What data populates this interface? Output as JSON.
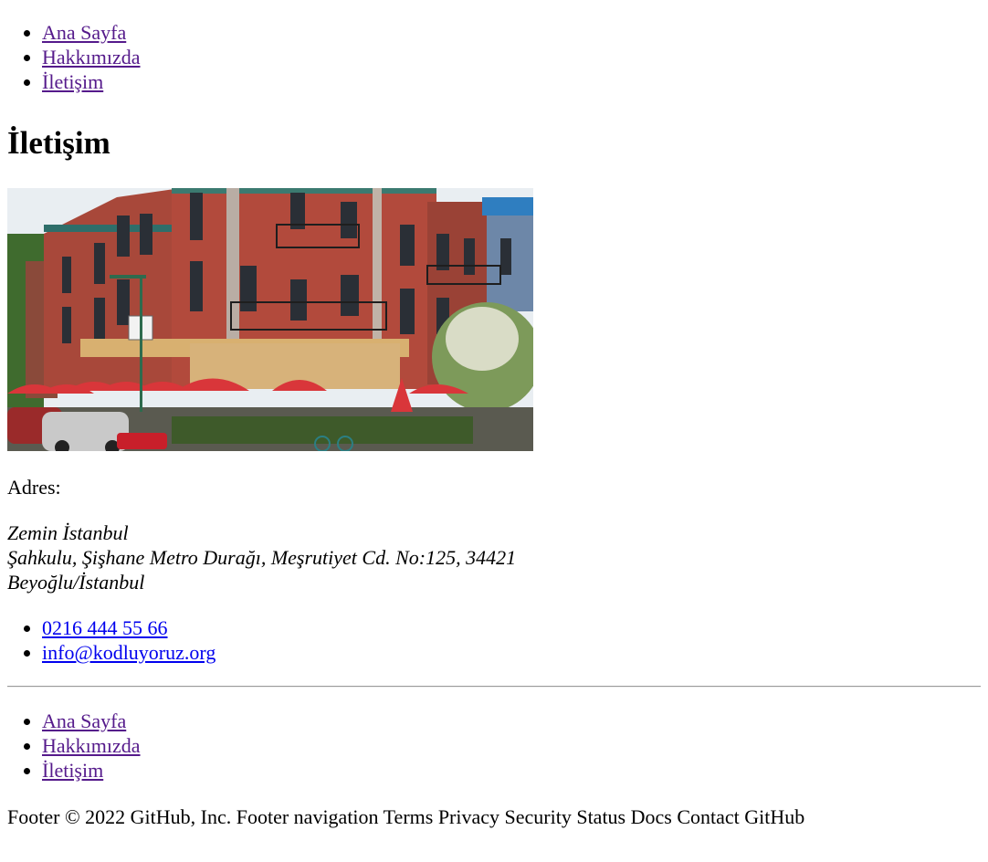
{
  "top_nav": {
    "items": [
      "Ana Sayfa",
      "Hakkımızda",
      "İletişim"
    ]
  },
  "page_title": "İletişim",
  "photo": {
    "description_icon": "building-photo"
  },
  "address_label": "Adres:",
  "address": {
    "line1": "Zemin İstanbul",
    "line2": "Şahkulu, Şişhane Metro Durağı, Meşrutiyet Cd. No:125, 34421",
    "line3": "Beyoğlu/İstanbul"
  },
  "contact": {
    "phone": "0216 444 55 66",
    "email": "info@kodluyoruz.org"
  },
  "footer_nav": {
    "items": [
      "Ana Sayfa",
      "Hakkımızda",
      "İletişim"
    ]
  },
  "footer_text": "Footer © 2022 GitHub, Inc. Footer navigation Terms Privacy Security Status Docs Contact GitHub",
  "colors": {
    "visited_link": "#551a8b",
    "link": "#0000ee",
    "hr": "#9a9a9a"
  }
}
